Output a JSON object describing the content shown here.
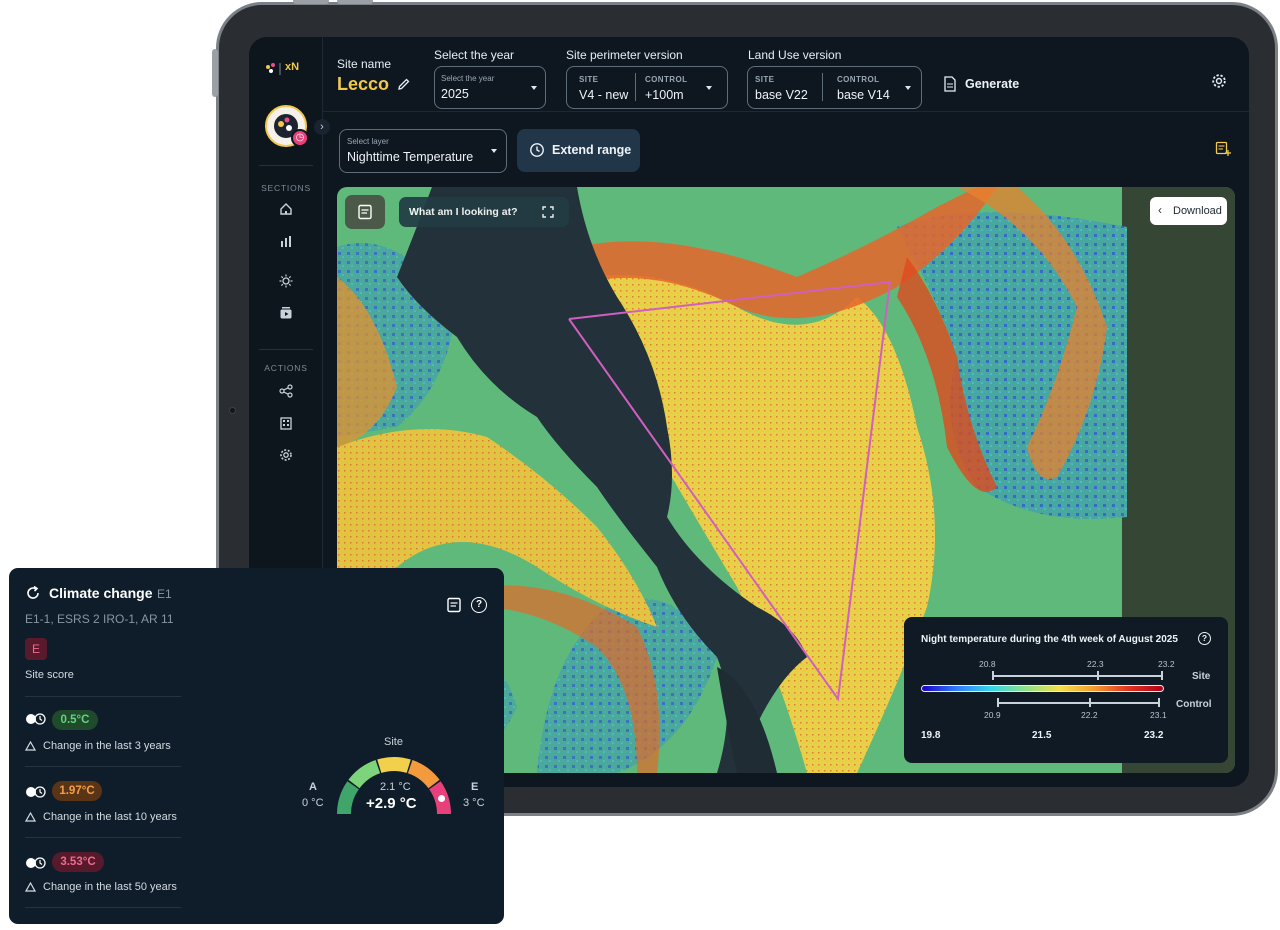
{
  "app": {
    "logo_text": "xN"
  },
  "header": {
    "site_name_label": "Site name",
    "site_name": "Lecco",
    "year_label": "Select the year",
    "year_small": "Select the year",
    "year_value": "2025",
    "perimeter_label": "Site perimeter version",
    "perimeter_site_small": "SITE",
    "perimeter_site_value": "V4 - new",
    "perimeter_control_small": "CONTROL",
    "perimeter_control_value": "+100m",
    "landuse_label": "Land Use version",
    "landuse_site_small": "SITE",
    "landuse_site_value": "base V22",
    "landuse_control_small": "CONTROL",
    "landuse_control_value": "base V14",
    "generate_label": "Generate"
  },
  "sidebar": {
    "sections_label": "SECTIONS",
    "actions_label": "ACTIONS",
    "section_icons": [
      "home-icon",
      "bar-chart-icon",
      "sun-icon",
      "media-icon"
    ],
    "action_icons": [
      "share-icon",
      "building-icon",
      "gear-icon"
    ]
  },
  "toolbar": {
    "layer_small": "Select layer",
    "layer_value": "Nighttime Temperature",
    "extend_label": "Extend range"
  },
  "map": {
    "help_label": "What am I looking at?",
    "download_label": "Download"
  },
  "legend": {
    "title": "Night temperature during the 4th week of August 2025",
    "site_label": "Site",
    "control_label": "Control",
    "site_ticks": [
      "20.8",
      "22.3",
      "23.2"
    ],
    "control_ticks": [
      "20.9",
      "22.2",
      "23.1"
    ],
    "scale_values": [
      "19.8",
      "21.5",
      "23.2"
    ],
    "scale_colors": [
      "#1b00c8",
      "#2f7cff",
      "#35d5e8",
      "#8ee08a",
      "#f4e04a",
      "#f39a2c",
      "#e0331f",
      "#b0001a"
    ]
  },
  "climate": {
    "title": "Climate change",
    "title_code": "E1",
    "subtitle": "E1-1, ESRS 2 IRO-1, AR 11",
    "score_badge": "E",
    "score_label": "Site score",
    "rows": [
      {
        "value": "0.5°C",
        "label": "Change in the last 3 years",
        "bg": "#1f4a2c",
        "fg": "#63d47f"
      },
      {
        "value": "1.97°C",
        "label": "Change in the last 10 years",
        "bg": "#5a3416",
        "fg": "#f2a04a"
      },
      {
        "value": "3.53°C",
        "label": "Change in the last 50 years",
        "bg": "#571a2c",
        "fg": "#f06a8e"
      }
    ],
    "gauge": {
      "site_label": "Site",
      "baseline": "2.1 °C",
      "delta": "+2.9 °C",
      "left_letter": "A",
      "left_value": "0 °C",
      "right_letter": "E",
      "right_value": "3 °C",
      "segment_colors": [
        "#3fa56a",
        "#7dd47a",
        "#f3d04c",
        "#f39a3c",
        "#e8407a"
      ]
    }
  }
}
